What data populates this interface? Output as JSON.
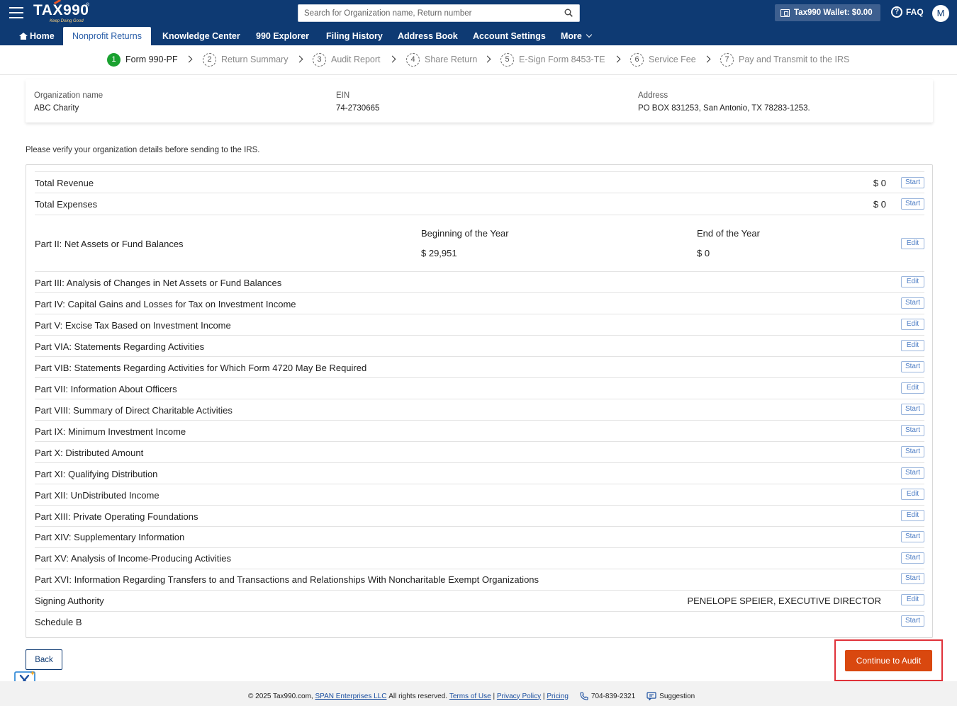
{
  "header": {
    "logo_text_1": "TA",
    "logo_text_x": "X",
    "logo_text_2": "990",
    "logo_reg": "®",
    "logo_tagline": "Keep Doing Good",
    "search_placeholder": "Search for Organization name, Return number",
    "wallet_label": "Tax990 Wallet: $0.00",
    "faq_label": "FAQ",
    "avatar_initial": "M"
  },
  "nav": {
    "home": "Home",
    "nonprofit_returns": "Nonprofit Returns",
    "knowledge_center": "Knowledge Center",
    "explorer": "990 Explorer",
    "filing_history": "Filing History",
    "address_book": "Address Book",
    "account_settings": "Account Settings",
    "more": "More"
  },
  "steps": [
    {
      "num": "1",
      "label": "Form 990-PF"
    },
    {
      "num": "2",
      "label": "Return Summary"
    },
    {
      "num": "3",
      "label": "Audit Report"
    },
    {
      "num": "4",
      "label": "Share Return"
    },
    {
      "num": "5",
      "label": "E-Sign Form 8453-TE"
    },
    {
      "num": "6",
      "label": "Service Fee"
    },
    {
      "num": "7",
      "label": "Pay and Transmit to the IRS"
    }
  ],
  "org": {
    "name_label": "Organization name",
    "name_value": "ABC Charity",
    "ein_label": "EIN",
    "ein_value": "74-2730665",
    "address_label": "Address",
    "address_value": "PO BOX 831253, San Antonio, TX 78283-1253."
  },
  "verify_note": "Please verify your organization details before sending to the IRS.",
  "rows": {
    "total_revenue": {
      "label": "Total Revenue",
      "amount": "$ 0",
      "action": "Start"
    },
    "total_expenses": {
      "label": "Total Expenses",
      "amount": "$ 0",
      "action": "Start"
    },
    "part2": {
      "label": "Part II: Net Assets or Fund Balances",
      "beg_head": "Beginning of the Year",
      "beg_value": "$ 29,951",
      "end_head": "End of the Year",
      "end_value": "$ 0",
      "action": "Edit"
    },
    "list": [
      {
        "label": "Part III: Analysis of Changes in Net Assets or Fund Balances",
        "action": "Edit"
      },
      {
        "label": "Part IV: Capital Gains and Losses for Tax on Investment Income",
        "action": "Start"
      },
      {
        "label": "Part V: Excise Tax Based on Investment Income",
        "action": "Edit"
      },
      {
        "label": "Part VIA: Statements Regarding Activities",
        "action": "Edit"
      },
      {
        "label": "Part VIB: Statements Regarding Activities for Which Form 4720 May Be Required",
        "action": "Start"
      },
      {
        "label": "Part VII: Information About Officers",
        "action": "Edit"
      },
      {
        "label": "Part VIII: Summary of Direct Charitable Activities",
        "action": "Start"
      },
      {
        "label": "Part IX: Minimum Investment Income",
        "action": "Start"
      },
      {
        "label": "Part X: Distributed Amount",
        "action": "Start"
      },
      {
        "label": "Part XI: Qualifying Distribution",
        "action": "Start"
      },
      {
        "label": "Part XII: UnDistributed Income",
        "action": "Edit"
      },
      {
        "label": "Part XIII: Private Operating Foundations",
        "action": "Edit"
      },
      {
        "label": "Part XIV: Supplementary Information",
        "action": "Start"
      },
      {
        "label": "Part XV: Analysis of Income-Producing Activities",
        "action": "Start"
      },
      {
        "label": "Part XVI: Information Regarding Transfers to and Transactions and Relationships With Noncharitable Exempt Organizations",
        "action": "Start"
      }
    ],
    "signing": {
      "label": "Signing Authority",
      "value": "PENELOPE SPEIER, EXECUTIVE DIRECTOR",
      "action": "Edit"
    },
    "schedule_b": {
      "label": "Schedule B",
      "action": "Start"
    }
  },
  "buttons": {
    "back": "Back",
    "continue": "Continue to Audit"
  },
  "footer": {
    "copyright": "© 2025 Tax990.com,",
    "company": "SPAN Enterprises LLC",
    "rights": "All rights reserved.",
    "terms": "Terms of Use",
    "privacy": "Privacy Policy",
    "pricing": "Pricing",
    "sep": "|",
    "phone": "704-839-2321",
    "suggestion": "Suggestion"
  },
  "colors": {
    "brand_navy": "#0e3a73",
    "accent_orange": "#d9480f",
    "highlight_red": "#e0323a",
    "step_green": "#1aa130"
  }
}
